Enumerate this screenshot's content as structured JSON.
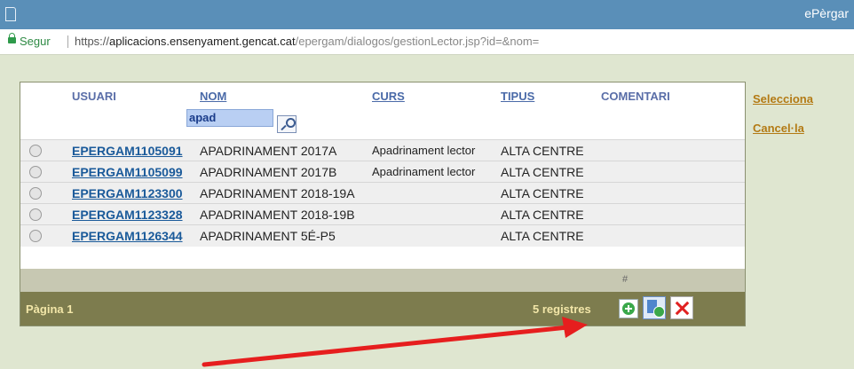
{
  "window": {
    "title": "ePèrgar"
  },
  "address": {
    "secure_label": "Segur",
    "url_scheme": "https://",
    "url_host": "aplicacions.ensenyament.gencat.cat",
    "url_path": "/epergam/dialogos/gestionLector.jsp?id=&nom="
  },
  "table": {
    "headers": {
      "usuari": "USUARI",
      "nom": "NOM",
      "curs": "CURS",
      "tipus": "TIPUS",
      "comentari": "COMENTARI"
    },
    "filter": {
      "nom_value": "apad"
    },
    "rows": [
      {
        "usuari": "EPERGAM1105091",
        "nom": "APADRINAMENT 2017A",
        "curs": "Apadrinament lector",
        "tipus": "ALTA CENTRE"
      },
      {
        "usuari": "EPERGAM1105099",
        "nom": "APADRINAMENT 2017B",
        "curs": "Apadrinament lector",
        "tipus": "ALTA CENTRE"
      },
      {
        "usuari": "EPERGAM1123300",
        "nom": "APADRINAMENT 2018-19A",
        "curs": "",
        "tipus": "ALTA CENTRE"
      },
      {
        "usuari": "EPERGAM1123328",
        "nom": "APADRINAMENT 2018-19B",
        "curs": "",
        "tipus": "ALTA CENTRE"
      },
      {
        "usuari": "EPERGAM1126344",
        "nom": "APADRINAMENT 5É-P5",
        "curs": "",
        "tipus": "ALTA CENTRE"
      }
    ],
    "hash_label": "#",
    "footer": {
      "page": "Pàgina 1",
      "count": "5 registres"
    }
  },
  "side": {
    "select": "Selecciona",
    "cancel": "Cancel·la"
  },
  "icons": {
    "add": "add-icon",
    "copy_add": "copy-add-icon",
    "delete": "delete-icon",
    "search": "search-icon",
    "annotation": "red-arrow-annotation"
  },
  "colors": {
    "accent": "#5a8fb8",
    "footer": "#7d7c4e",
    "side_link": "#b37a14",
    "arrow": "#e61e1e"
  }
}
